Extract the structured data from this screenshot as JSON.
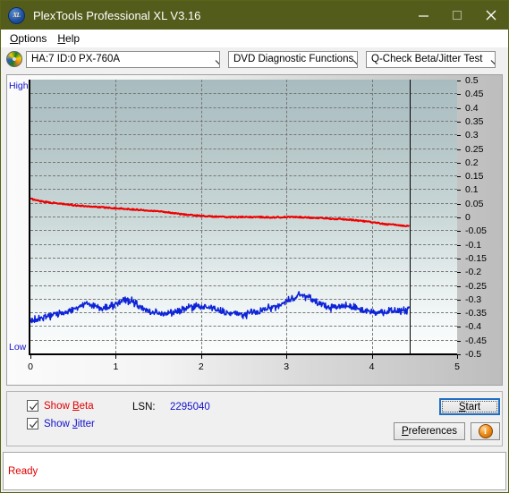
{
  "window": {
    "title": "PlexTools Professional XL V3.16",
    "app_icon": "xl-logo-icon",
    "minimize": "minimize-icon",
    "maximize": "maximize-icon",
    "close": "close-icon",
    "titlebar_color": "#545c1c"
  },
  "menubar": {
    "items": [
      {
        "label": "Options",
        "accel": "O"
      },
      {
        "label": "Help",
        "accel": "H"
      }
    ]
  },
  "toolbar": {
    "device_icon": "disc-drive-icon",
    "device_select": {
      "value": "HA:7 ID:0  PX-760A",
      "options": [
        "HA:7 ID:0  PX-760A"
      ]
    },
    "function_select": {
      "value": "DVD Diagnostic Functions",
      "options": [
        "DVD Diagnostic Functions"
      ]
    },
    "test_select": {
      "value": "Q-Check Beta/Jitter Test",
      "options": [
        "Q-Check Beta/Jitter Test"
      ]
    }
  },
  "graph": {
    "label_high": "High",
    "label_low": "Low",
    "cursor_position_x": 4.44
  },
  "controls": {
    "show_beta": {
      "label": "Show Beta",
      "accel": "B",
      "checked": true,
      "color": "#e00000"
    },
    "show_jitter": {
      "label": "Show Jitter",
      "accel": "J",
      "checked": true,
      "color": "#1111cc"
    },
    "lsn_label": "LSN:",
    "lsn_value": "2295040",
    "start_button": {
      "label": "Start",
      "accel": "S"
    },
    "preferences_button": {
      "label": "Preferences",
      "accel": "P"
    },
    "info_button": {
      "icon": "info-icon",
      "glyph": "i"
    }
  },
  "statusbar": {
    "text": "Ready"
  },
  "chart_data": {
    "type": "line",
    "title": "Q-Check Beta/Jitter Test",
    "xlabel": "",
    "ylabel": "",
    "xlim": [
      0,
      5
    ],
    "ylim": [
      -0.5,
      0.5
    ],
    "grid": true,
    "xticks": [
      0,
      1,
      2,
      3,
      4,
      5
    ],
    "yticks": [
      0.5,
      0.45,
      0.4,
      0.35,
      0.3,
      0.25,
      0.2,
      0.15,
      0.1,
      0.05,
      0,
      -0.05,
      -0.1,
      -0.15,
      -0.2,
      -0.25,
      -0.3,
      -0.35,
      -0.4,
      -0.45,
      -0.5
    ],
    "ytick_labels": [
      "0.5",
      "0.45",
      "0.4",
      "0.35",
      "0.3",
      "0.25",
      "0.2",
      "0.15",
      "0.1",
      "0.05",
      "0",
      "-0.05",
      "-0.1",
      "-0.15",
      "-0.2",
      "-0.25",
      "-0.3",
      "-0.35",
      "-0.4",
      "-0.45",
      "-0.5"
    ],
    "axis_left_label": "High",
    "axis_left_label_bottom": "Low",
    "data_end_x": 4.44,
    "series": [
      {
        "name": "Show Beta",
        "color": "#ee0000",
        "x": [
          0.0,
          0.09,
          0.19,
          0.28,
          0.37,
          0.46,
          0.56,
          0.65,
          0.74,
          0.83,
          0.93,
          1.02,
          1.11,
          1.2,
          1.3,
          1.39,
          1.48,
          1.57,
          1.67,
          1.76,
          1.85,
          1.94,
          2.04,
          2.13,
          2.22,
          2.31,
          2.41,
          2.5,
          2.59,
          2.68,
          2.78,
          2.87,
          2.96,
          3.05,
          3.15,
          3.24,
          3.33,
          3.42,
          3.52,
          3.61,
          3.7,
          3.79,
          3.89,
          3.98,
          4.07,
          4.16,
          4.26,
          4.35,
          4.44
        ],
        "y": [
          0.065,
          0.058,
          0.053,
          0.049,
          0.046,
          0.043,
          0.04,
          0.038,
          0.036,
          0.034,
          0.032,
          0.03,
          0.028,
          0.026,
          0.024,
          0.022,
          0.02,
          0.017,
          0.013,
          0.009,
          0.006,
          0.004,
          0.002,
          0.0,
          -0.001,
          -0.002,
          -0.002,
          -0.002,
          -0.002,
          -0.002,
          -0.003,
          -0.003,
          -0.002,
          -0.002,
          -0.002,
          -0.003,
          -0.005,
          -0.006,
          -0.008,
          -0.009,
          -0.011,
          -0.013,
          -0.016,
          -0.02,
          -0.024,
          -0.028,
          -0.03,
          -0.033,
          -0.035
        ]
      },
      {
        "name": "Show Jitter",
        "color": "#0d24d8",
        "x": [
          0.0,
          0.09,
          0.19,
          0.28,
          0.37,
          0.46,
          0.56,
          0.65,
          0.74,
          0.83,
          0.93,
          1.02,
          1.11,
          1.2,
          1.3,
          1.39,
          1.48,
          1.57,
          1.67,
          1.76,
          1.85,
          1.94,
          2.04,
          2.13,
          2.22,
          2.31,
          2.41,
          2.5,
          2.59,
          2.68,
          2.78,
          2.87,
          2.96,
          3.05,
          3.15,
          3.24,
          3.33,
          3.42,
          3.52,
          3.61,
          3.7,
          3.79,
          3.89,
          3.98,
          4.07,
          4.16,
          4.26,
          4.35,
          4.44
        ],
        "y": [
          -0.38,
          -0.373,
          -0.366,
          -0.358,
          -0.352,
          -0.344,
          -0.33,
          -0.32,
          -0.326,
          -0.334,
          -0.328,
          -0.316,
          -0.305,
          -0.31,
          -0.335,
          -0.348,
          -0.352,
          -0.353,
          -0.352,
          -0.345,
          -0.33,
          -0.328,
          -0.331,
          -0.335,
          -0.344,
          -0.352,
          -0.356,
          -0.358,
          -0.352,
          -0.345,
          -0.336,
          -0.33,
          -0.32,
          -0.3,
          -0.285,
          -0.292,
          -0.308,
          -0.322,
          -0.332,
          -0.33,
          -0.326,
          -0.33,
          -0.34,
          -0.348,
          -0.348,
          -0.346,
          -0.345,
          -0.344,
          -0.342
        ],
        "noise_amplitude": 0.018
      }
    ]
  }
}
